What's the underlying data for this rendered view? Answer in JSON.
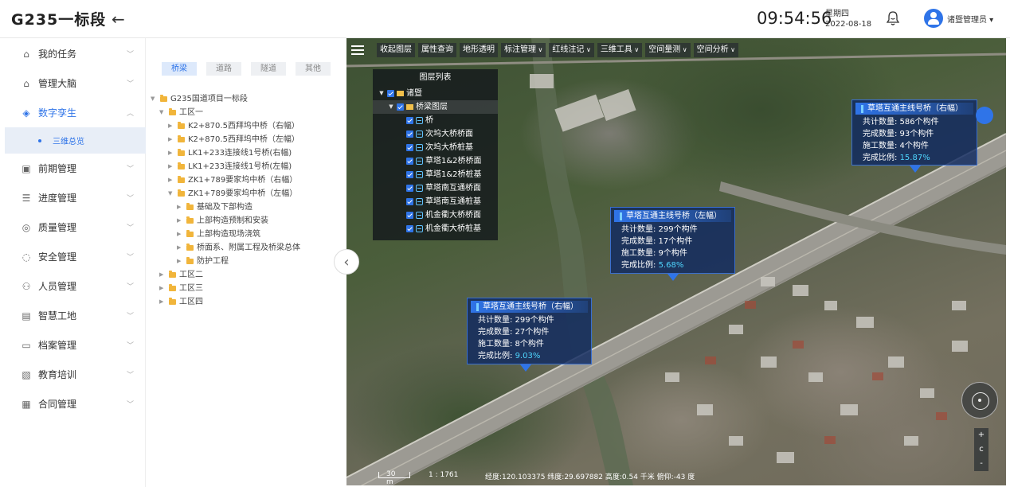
{
  "header": {
    "logo": "G235一标段",
    "back_icon": "arrow-left-icon",
    "time": "09:54:56",
    "weekday": "星期四",
    "date": "2022-08-18",
    "user": "诸暨管理员"
  },
  "sidebar": {
    "items": [
      {
        "label": "我的任务",
        "icon": "home-icon",
        "glyph": "⌂"
      },
      {
        "label": "管理大脑",
        "icon": "home-icon",
        "glyph": "⌂"
      },
      {
        "label": "数字孪生",
        "icon": "cube-icon",
        "glyph": "◈",
        "active": true,
        "sub": [
          "三维总览"
        ]
      },
      {
        "label": "前期管理",
        "icon": "calendar-icon",
        "glyph": "▣"
      },
      {
        "label": "进度管理",
        "icon": "progress-icon",
        "glyph": "☰"
      },
      {
        "label": "质量管理",
        "icon": "quality-icon",
        "glyph": "◎"
      },
      {
        "label": "安全管理",
        "icon": "shield-icon",
        "glyph": "◌"
      },
      {
        "label": "人员管理",
        "icon": "people-icon",
        "glyph": "⚇"
      },
      {
        "label": "智慧工地",
        "icon": "monitor-icon",
        "glyph": "▤"
      },
      {
        "label": "档案管理",
        "icon": "folder-icon",
        "glyph": "▭"
      },
      {
        "label": "教育培训",
        "icon": "training-icon",
        "glyph": "▧"
      },
      {
        "label": "合同管理",
        "icon": "contract-icon",
        "glyph": "▦"
      }
    ]
  },
  "tree": {
    "tabs": [
      {
        "label": "桥梁",
        "active": true
      },
      {
        "label": "道路"
      },
      {
        "label": "隧道"
      },
      {
        "label": "其他"
      }
    ],
    "nodes": [
      {
        "label": "G235国道项目一标段",
        "level": 0,
        "expanded": true
      },
      {
        "label": "工区一",
        "level": 1,
        "expanded": true
      },
      {
        "label": "K2+870.5西拜坞中桥（右幅）",
        "level": 2
      },
      {
        "label": "K2+870.5西拜坞中桥（左幅）",
        "level": 2
      },
      {
        "label": "LK1+233连接线1号桥(右幅)",
        "level": 2
      },
      {
        "label": "LK1+233连接线1号桥(左幅)",
        "level": 2
      },
      {
        "label": "ZK1+789要家坞中桥（右幅）",
        "level": 2
      },
      {
        "label": "ZK1+789要家坞中桥（左幅）",
        "level": 2,
        "expanded": true
      },
      {
        "label": "基础及下部构造",
        "level": 3
      },
      {
        "label": "上部构造预制和安装",
        "level": 3
      },
      {
        "label": "上部构造现场浇筑",
        "level": 3
      },
      {
        "label": "桥面系、附属工程及桥梁总体",
        "level": 3
      },
      {
        "label": "防护工程",
        "level": 3
      },
      {
        "label": "工区二",
        "level": 1
      },
      {
        "label": "工区三",
        "level": 1
      },
      {
        "label": "工区四",
        "level": 1
      }
    ]
  },
  "toolbar": {
    "buttons": [
      {
        "label": "收起图层",
        "dropdown": false
      },
      {
        "label": "属性查询",
        "dropdown": false
      },
      {
        "label": "地形透明",
        "dropdown": false
      },
      {
        "label": "标注管理",
        "dropdown": true
      },
      {
        "label": "红线注记",
        "dropdown": true
      },
      {
        "label": "三维工具",
        "dropdown": true
      },
      {
        "label": "空间量测",
        "dropdown": true
      },
      {
        "label": "空间分析",
        "dropdown": true
      }
    ]
  },
  "layer_panel": {
    "title": "图层列表",
    "rows": [
      {
        "label": "诸暨",
        "type": "folder",
        "level": 0,
        "arrow": true
      },
      {
        "label": "桥梁图层",
        "type": "folder",
        "level": 1,
        "arrow": true,
        "selected": true
      },
      {
        "label": "桥",
        "type": "layer",
        "level": 2
      },
      {
        "label": "次坞大桥桥面",
        "type": "layer",
        "level": 2
      },
      {
        "label": "次坞大桥桩基",
        "type": "layer",
        "level": 2
      },
      {
        "label": "草塔1&2桥桥面",
        "type": "layer",
        "level": 2
      },
      {
        "label": "草塔1&2桥桩基",
        "type": "layer",
        "level": 2
      },
      {
        "label": "草塔南互通桥面",
        "type": "layer",
        "level": 2
      },
      {
        "label": "草塔南互通桩基",
        "type": "layer",
        "level": 2
      },
      {
        "label": "机金衢大桥桥面",
        "type": "layer",
        "level": 2
      },
      {
        "label": "机金衢大桥桩基",
        "type": "layer",
        "level": 2
      }
    ]
  },
  "popups": [
    {
      "title": "草塔互通主线号桥（右幅）",
      "total": "共计数量: 586个构件",
      "done": "完成数量: 93个构件",
      "working": "施工数量: 4个构件",
      "ratio_label": "完成比例: ",
      "ratio": "15.87%"
    },
    {
      "title": "草塔互通主线号桥（左幅）",
      "total": "共计数量: 299个构件",
      "done": "完成数量: 17个构件",
      "working": "施工数量: 9个构件",
      "ratio_label": "完成比例: ",
      "ratio": "5.68%"
    },
    {
      "title": "草塔互通主线号桥（右幅）",
      "total": "共计数量: 299个构件",
      "done": "完成数量: 27个构件",
      "working": "施工数量: 8个构件",
      "ratio_label": "完成比例: ",
      "ratio": "9.03%"
    }
  ],
  "map_status": {
    "scale": "30 m",
    "ratio": "1 : 1761",
    "coords": "经度:120.103375  纬度:29.697882  高度:0.54 千米  俯仰:-43 度"
  },
  "map_controls": {
    "zoom_in": "+",
    "reset": "c",
    "zoom_out": "-",
    "compass_icon": "compass-icon"
  },
  "colors": {
    "accent": "#2f74e8",
    "popup_bg": "#102a60",
    "highlight": "#4fd6ff"
  }
}
